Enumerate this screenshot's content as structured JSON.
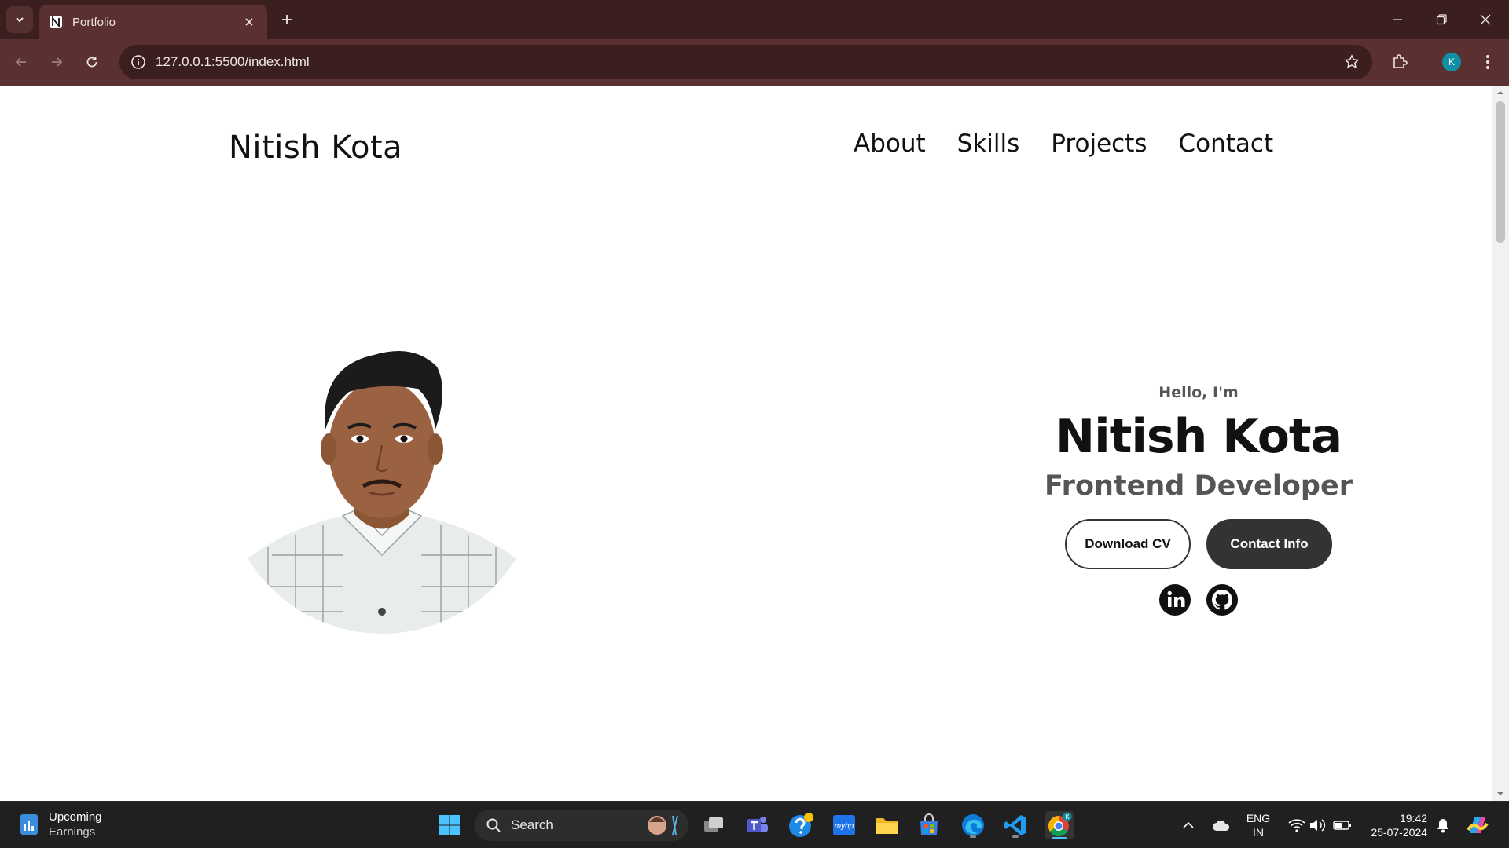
{
  "browser": {
    "tab_title": "Portfolio",
    "url": "127.0.0.1:5500/index.html",
    "profile_initial": "K"
  },
  "site": {
    "logo": "Nitish Kota",
    "nav": [
      "About",
      "Skills",
      "Projects",
      "Contact"
    ],
    "hero": {
      "greeting": "Hello, I'm",
      "name": "Nitish Kota",
      "role": "Frontend Developer",
      "download_cv": "Download CV",
      "contact_info": "Contact Info"
    },
    "social": [
      "linkedin-icon",
      "github-icon"
    ]
  },
  "taskbar": {
    "widget_title": "Upcoming",
    "widget_sub": "Earnings",
    "search_label": "Search",
    "lang_top": "ENG",
    "lang_bottom": "IN",
    "time": "19:42",
    "date": "25-07-2024"
  },
  "colors": {
    "chrome_dark": "#3b1f1f",
    "chrome_toolbar": "#5a3030",
    "button_dark": "#333333",
    "taskbar": "#202020"
  }
}
